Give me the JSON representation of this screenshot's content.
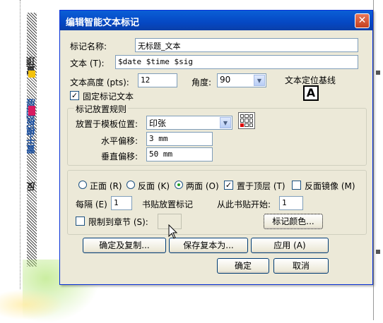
{
  "background": {
    "vertical_texts": [
      {
        "text": "置顶",
        "color": "#222222"
      },
      {
        "text": "置于模板顶层",
        "color": "#1a4fa0"
      },
      {
        "text": "反",
        "color": "#222222"
      }
    ],
    "colored_chars": [
      "#d81b60",
      "#f4c20d"
    ]
  },
  "dialog": {
    "title": "编辑智能文本标记",
    "close_glyph": "✕",
    "name_label": "标记名称:",
    "name_value": "无标题_文本",
    "text_label": "文本 (T):",
    "text_value": "$date $time     $sig",
    "height_label": "文本高度 (pts):",
    "height_value": "12",
    "angle_label": "角度:",
    "angle_value": "90",
    "baseline_label": "文本定位基线",
    "baseline_icon": "A",
    "fixed_label": "固定标记文本",
    "fixed_checked": true,
    "placement_group_title": "标记放置规则",
    "place_on_label": "放置于模板位置:",
    "place_on_value": "印张",
    "h_offset_label": "水平偏移:",
    "h_offset_value": "3 mm",
    "v_offset_label": "垂直偏移:",
    "v_offset_value": "50 mm",
    "side_options": [
      {
        "label": "正面 (R)",
        "selected": false
      },
      {
        "label": "反面 (K)",
        "selected": false
      },
      {
        "label": "两面 (O)",
        "selected": true
      }
    ],
    "top_layer_label": "置于顶层 (T)",
    "top_layer_checked": true,
    "mirror_label": "反面镜像 (M)",
    "mirror_checked": false,
    "every_label": "每隔 (E)",
    "every_value": "1",
    "every_suffix": "书贴放置标记",
    "start_label": "从此书贴开始:",
    "start_value": "1",
    "limit_label": "限制到章节 (S):",
    "limit_checked": false,
    "limit_value": "",
    "color_button": "标记颜色...",
    "btn_ok_copy": "确定及复制...",
    "btn_save_copy": "保存复本为...",
    "btn_apply": "应用 (A)",
    "btn_ok": "确定",
    "btn_cancel": "取消"
  }
}
